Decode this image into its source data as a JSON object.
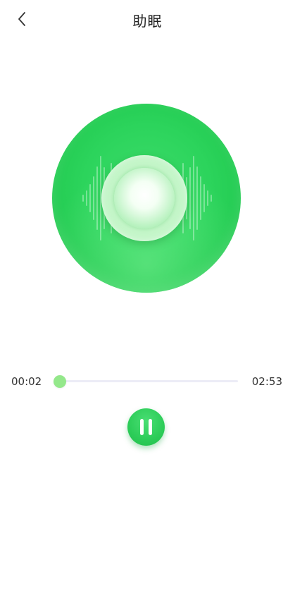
{
  "header": {
    "title": "助眠",
    "back_icon": "chevron-left-icon"
  },
  "player": {
    "current_time": "00:02",
    "total_time": "02:53",
    "progress_fraction": 0.012,
    "state_icon": "pause-icon"
  },
  "colors": {
    "accent": "#2ccc58",
    "progress": "#94e88b",
    "track": "#ececf6"
  }
}
